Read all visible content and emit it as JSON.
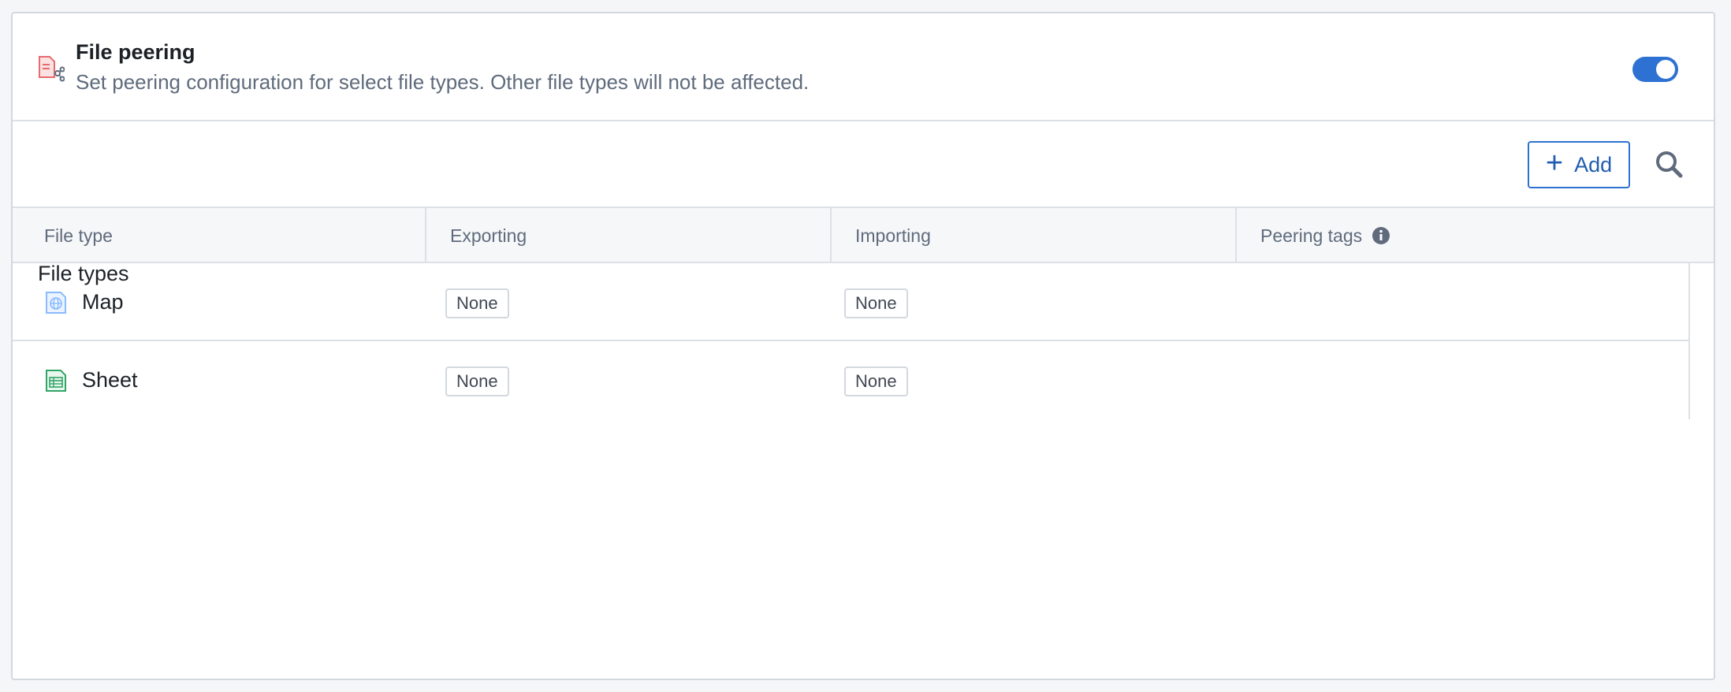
{
  "header": {
    "title": "File peering",
    "subtitle": "Set peering configuration for select file types. Other file types will not be affected.",
    "icon": "file-peering-icon",
    "toggle_on": true
  },
  "toolbar": {
    "section_title": "File types",
    "add_label": "Add"
  },
  "table": {
    "columns": [
      "File type",
      "Exporting",
      "Importing",
      "Peering tags"
    ],
    "rows": [
      {
        "file_type": "Map",
        "icon": "globe-icon",
        "exporting": "None",
        "importing": "None",
        "peering_tags": ""
      },
      {
        "file_type": "Sheet",
        "icon": "spreadsheet-icon",
        "exporting": "None",
        "importing": "None",
        "peering_tags": ""
      }
    ]
  },
  "colors": {
    "accent": "#2d72d2",
    "map_icon": "#8abbff",
    "sheet_icon": "#32a467",
    "header_icon": "#e76a6e"
  }
}
